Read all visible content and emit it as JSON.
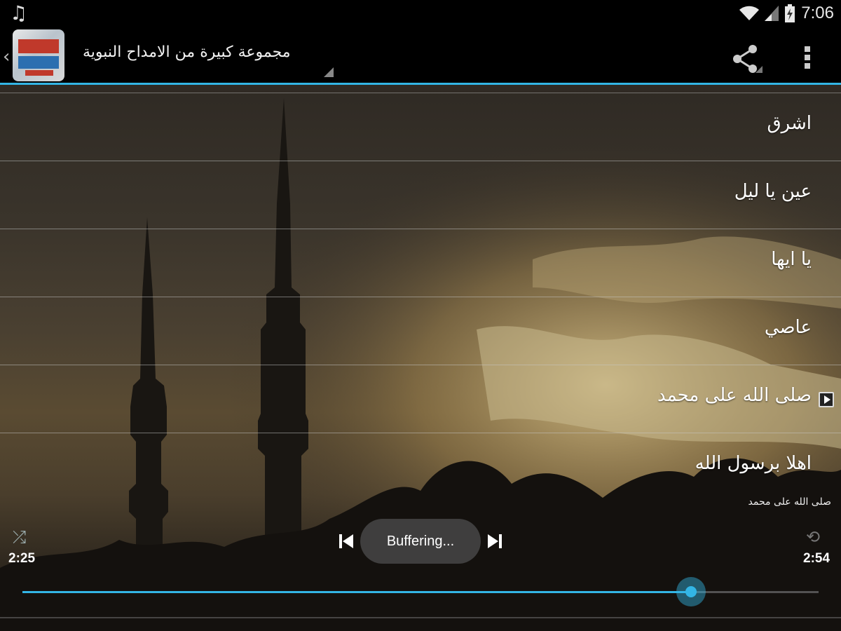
{
  "status_bar": {
    "time": "7:06",
    "icons": [
      "music-note-icon",
      "wifi-icon",
      "signal-icon",
      "battery-charging-icon"
    ]
  },
  "action_bar": {
    "title": "مجموعة كبيرة من الامداح النبوية",
    "icons": [
      "up-caret-icon",
      "app-icon",
      "share-icon",
      "overflow-menu-icon"
    ]
  },
  "tracks": [
    {
      "title": "اشرق",
      "playing": false
    },
    {
      "title": "عين يا ليل",
      "playing": false
    },
    {
      "title": "يا ايها",
      "playing": false
    },
    {
      "title": "عاصي",
      "playing": false
    },
    {
      "title": "صلى الله على محمد",
      "playing": true
    },
    {
      "title": "اهلا برسول الله",
      "playing": false
    }
  ],
  "player": {
    "now_playing": "صلى الله على محمد",
    "elapsed": "2:25",
    "duration": "2:54",
    "status": "Buffering...",
    "progress": 0.84,
    "accent_color": "#33b5e5"
  }
}
